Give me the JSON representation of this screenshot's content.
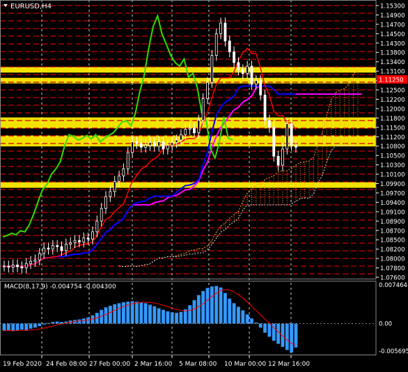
{
  "window": {
    "symbol_title": "EURUSD,H4",
    "menu_icon": "triangle-down-icon"
  },
  "colors": {
    "background": "#000000",
    "grid": "#ffffff",
    "level_red": "#cc0000",
    "level_yellow": "#ffee00",
    "price_tag_bg": "#ff0000",
    "candle": "#ffffff",
    "tenkan": "#ff0000",
    "kijun": "#0000ff",
    "chikou": "#33dd00",
    "senkou_a": "#ff9933",
    "senkou_b": "#dddddd",
    "envelope": "#ff00ff",
    "macd_hist": "#3399ff",
    "macd_signal": "#ff0000"
  },
  "price_axis": {
    "labels": [
      "1.15300",
      "1.14900",
      "1.14700",
      "1.14500",
      "1.14300",
      "1.13800",
      "1.13400",
      "1.13100",
      "1.12900",
      "1.12500",
      "1.12200",
      "1.12000",
      "1.11800",
      "1.11500",
      "1.11200",
      "1.10800",
      "1.10500",
      "1.10300",
      "1.10100",
      "1.09900",
      "1.09700",
      "1.09400",
      "1.09100",
      "1.08900",
      "1.08700",
      "1.08500",
      "1.08200",
      "1.08000",
      "1.07800",
      "1.07600"
    ],
    "current_price": "1.11250"
  },
  "time_axis": {
    "labels": [
      "19 Feb 2020",
      "24 Feb 08:00",
      "27 Feb 00:00",
      "2 Mar 16:00",
      "5 Mar 08:00",
      "10 Mar 00:00",
      "12 Mar 16:00"
    ]
  },
  "macd": {
    "title": "MACD(8,17,9) -0.004754 -0.004300",
    "axis_labels": [
      "0.007464",
      "0.00",
      "-0.005695"
    ]
  },
  "chart_data": {
    "type": "line",
    "title": "EURUSD,H4",
    "ylim": [
      1.076,
      1.153
    ],
    "x_tick_labels": [
      "19 Feb 2020",
      "24 Feb 08:00",
      "27 Feb 00:00",
      "2 Mar 16:00",
      "5 Mar 08:00",
      "10 Mar 00:00",
      "12 Mar 16:00"
    ],
    "close": [
      1.0795,
      1.0792,
      1.0798,
      1.0793,
      1.079,
      1.0802,
      1.0808,
      1.0812,
      1.083,
      1.0845,
      1.0842,
      1.0852,
      1.0849,
      1.0838,
      1.0856,
      1.086,
      1.0866,
      1.0862,
      1.0873,
      1.087,
      1.089,
      1.092,
      1.0955,
      1.0988,
      1.1002,
      1.103,
      1.1045,
      1.1065,
      1.111,
      1.114,
      1.1135,
      1.1125,
      1.113,
      1.1138,
      1.1128,
      1.114,
      1.112,
      1.113,
      1.1138,
      1.1145,
      1.116,
      1.1175,
      1.1178,
      1.1165,
      1.12,
      1.126,
      1.1305,
      1.138,
      1.144,
      1.147,
      1.142,
      1.139,
      1.136,
      1.134,
      1.133,
      1.135,
      1.13,
      1.131,
      1.127,
      1.12,
      1.118,
      1.11,
      1.1075,
      1.112,
      1.119,
      1.113,
      1.1125
    ],
    "support_resistance_levels": [
      1.134,
      1.131,
      1.12,
      1.1185,
      1.115,
      1.1135,
      1.102
    ],
    "macd_histogram": [
      -0.0014,
      -0.0013,
      -0.0015,
      -0.0013,
      -0.0012,
      -0.0013,
      -0.001,
      -0.0008,
      -0.0005,
      -0.0002,
      0.0001,
      0.0003,
      0.0004,
      0.0003,
      0.0004,
      0.0006,
      0.0007,
      0.0008,
      0.001,
      0.0012,
      0.0016,
      0.0021,
      0.0027,
      0.0032,
      0.0035,
      0.0038,
      0.004,
      0.0042,
      0.0043,
      0.0044,
      0.0043,
      0.0042,
      0.004,
      0.0037,
      0.0034,
      0.003,
      0.0027,
      0.0024,
      0.0022,
      0.0021,
      0.0023,
      0.0028,
      0.0036,
      0.0046,
      0.0056,
      0.0064,
      0.007,
      0.0073,
      0.0074,
      0.0071,
      0.006,
      0.0049,
      0.004,
      0.0033,
      0.0026,
      0.0018,
      0.001,
      0.0002,
      -0.0008,
      -0.0018,
      -0.0026,
      -0.0034,
      -0.004,
      -0.0046,
      -0.0052,
      -0.0057,
      -0.0047
    ],
    "macd_range": [
      -0.005695,
      0.007464
    ]
  }
}
